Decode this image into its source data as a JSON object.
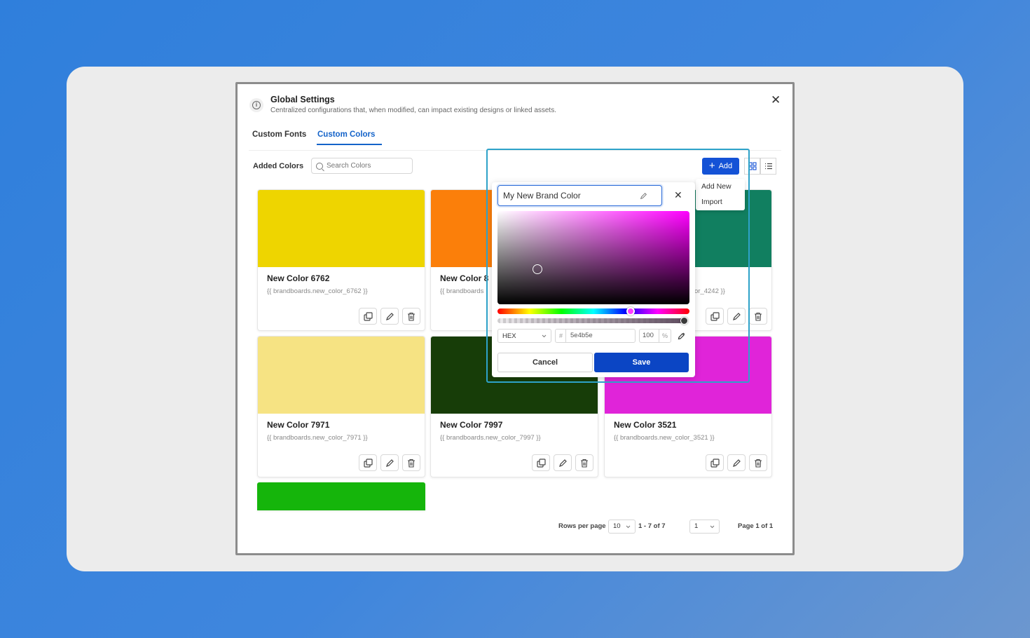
{
  "dialog": {
    "title": "Global Settings",
    "subtitle": "Centralized configurations that, when modified, can impact existing designs or linked assets."
  },
  "tabs": [
    {
      "label": "Custom Fonts",
      "active": false
    },
    {
      "label": "Custom Colors",
      "active": true
    }
  ],
  "toolbar": {
    "added_label": "Added Colors",
    "search_placeholder": "Search Colors",
    "add_label": "Add"
  },
  "add_menu": {
    "items": [
      "Add New",
      "Import"
    ]
  },
  "cards": [
    {
      "name": "New Color 6762",
      "token": "{{ brandboards.new_color_6762 }}",
      "color": "#eed500"
    },
    {
      "name": "New Color 8",
      "token": "{{ brandboards",
      "color": "#fb7f0a"
    },
    {
      "name": "",
      "token": "or_4242 }}",
      "color": "#117f60"
    },
    {
      "name": "New Color 7971",
      "token": "{{ brandboards.new_color_7971 }}",
      "color": "#f6e383"
    },
    {
      "name": "New Color 7997",
      "token": "{{ brandboards.new_color_7997 }}",
      "color": "#173d08"
    },
    {
      "name": "New Color 3521",
      "token": "{{ brandboards.new_color_3521 }}",
      "color": "#e024d9"
    },
    {
      "name": "",
      "token": "",
      "color": "#15b50b"
    }
  ],
  "picker": {
    "name_value": "My New Brand Color",
    "format": "HEX",
    "hash": "#",
    "hex_value": "5e4b5e",
    "alpha_value": "100",
    "alpha_unit": "%",
    "hue_color": "#ff00ff",
    "cancel_label": "Cancel",
    "save_label": "Save"
  },
  "pagination": {
    "rows_label": "Rows per page",
    "rows_value": "10",
    "range": "1 - 7 of 7",
    "page_value": "1",
    "page_label": "Page 1 of 1"
  },
  "colors": {
    "accent": "#1452d6",
    "tab_active": "#1463c9",
    "highlight": "#2ea2c9"
  }
}
